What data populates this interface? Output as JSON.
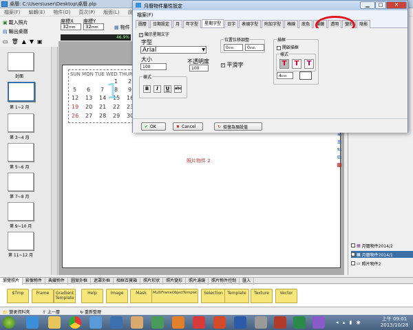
{
  "window": {
    "title": "桌曆: C:\\Users\\user\\Desktop\\桌曆.plp"
  },
  "menu": [
    "檔案(F)",
    "編輯(E)",
    "物件(O)",
    "頁次(P)",
    "版面(L)",
    "說明(H)"
  ],
  "toolbar": {
    "import_photo": "載入照片",
    "export_calendar": "輸出桌曆",
    "coord_x_label": "座標X",
    "coord_x_value": "32",
    "coord_y_label": "座標Y",
    "coord_y_value": "32",
    "unit": "mm",
    "object_label": "物件",
    "zoom": "46.9%"
  },
  "pages": [
    {
      "label": "封面"
    },
    {
      "label": "第 1~2 月"
    },
    {
      "label": "第 3~4 月"
    },
    {
      "label": "第 5~6 月"
    },
    {
      "label": "第 7~8 月"
    },
    {
      "label": "第 9~10 月"
    },
    {
      "label": "第 11~12 月"
    }
  ],
  "canvas": {
    "weekday_header": "SUN MON TUE WED THUR",
    "calendar_rows": [
      [
        "",
        "",
        "",
        "1",
        "2"
      ],
      [
        "5",
        "6",
        "7",
        "8",
        "9"
      ],
      [
        "12",
        "13",
        "14",
        "15",
        "16"
      ],
      [
        "19",
        "20",
        "21",
        "22",
        "23"
      ],
      [
        "26",
        "27",
        "28",
        "29",
        "30"
      ]
    ],
    "big_digit": "1",
    "photo_object_label": "照片物件 2"
  },
  "bottom_tabs": [
    "瀏覽照片",
    "影像物件",
    "典藏物件",
    "圖案外框",
    "遮罩外框",
    "相框百寶箱",
    "照片形狀",
    "照片變形",
    "照片濾鏡",
    "照片物件控制",
    "匯入"
  ],
  "folders": [
    "$Tmp",
    "Frame",
    "Gradient Template",
    "Help",
    "Image",
    "Mask",
    "MultiFrameObjectTemplat",
    "Selection",
    "Template",
    "Texture",
    "Vector"
  ],
  "status": {
    "folder_label": "變更資料夾",
    "up_label": "上一層",
    "refresh_label": "重新整理"
  },
  "layers": [
    {
      "label": "月曆物件2014/2",
      "selected": false
    },
    {
      "label": "月曆物件2014/1",
      "selected": true
    },
    {
      "label": "照片物件2",
      "selected": false
    }
  ],
  "dialog": {
    "title": "月曆物件屬性設定",
    "menu_file": "檔案(F)",
    "tabs": [
      "圖層",
      "日期設定",
      "月",
      "年字型",
      "星期字型",
      "日字",
      "表頭字型",
      "附加字型",
      "格線",
      "底色",
      "濾鏡",
      "透明",
      "變形",
      "陰影"
    ],
    "selected_tab": "星期字型",
    "show_weekday_label": "顯示星期文字",
    "font_label": "字型",
    "font_value": "Arial",
    "size_label": "大小",
    "size_value": "100",
    "opacity_label": "不透明度",
    "opacity_value": "100",
    "style_label": "樣式",
    "style_buttons": [
      "B",
      "I",
      "U",
      "abc"
    ],
    "offset_label": "位置位移調整",
    "offset_x": "0",
    "offset_y": "0",
    "offset_unit": "mm",
    "smooth_label": "平滑字",
    "stroke_group_label": "描框",
    "stroke_enable_label": "開啟描框",
    "stroke_style_label": "樣式",
    "stroke_width_value": "4",
    "stroke_unit": "mm",
    "ok_label": "OK",
    "cancel_label": "Cancel",
    "restore_label": "恢復為預設值"
  },
  "clock": {
    "time": "上午 09:01",
    "date": "2013/10/28"
  },
  "colors": {
    "accent_red": "#e0141e",
    "selection_blue": "#3a6ea5",
    "folder_yellow": "#f7e67a"
  }
}
